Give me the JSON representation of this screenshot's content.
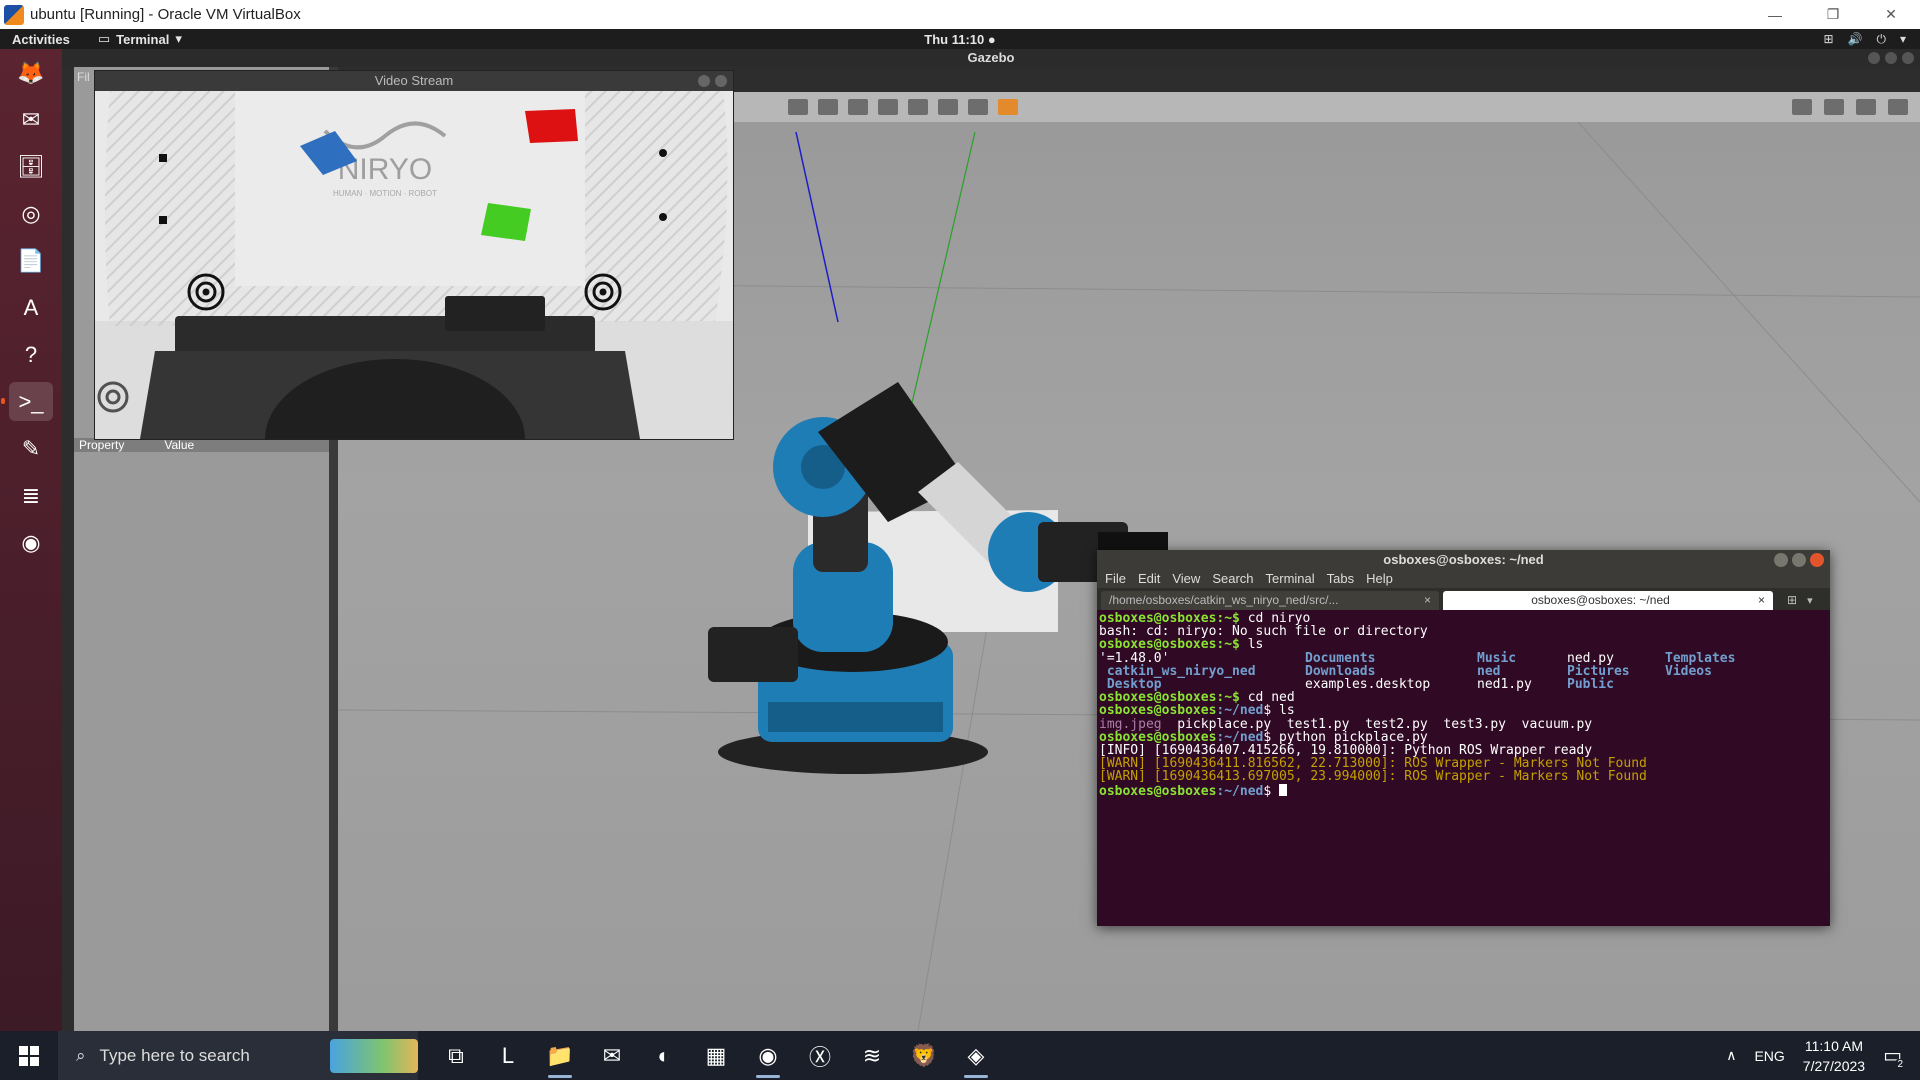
{
  "vbox": {
    "title": "ubuntu [Running] - Oracle VM VirtualBox",
    "minimize": "—",
    "restore": "❐",
    "close": "✕"
  },
  "ubuntu_panel": {
    "activities": "Activities",
    "app_menu": "Terminal",
    "clock": "Thu 11:10 ●"
  },
  "gazebo": {
    "title": "Gazebo",
    "file_menu": "Fil",
    "property_header": "Property",
    "value_header": "Value"
  },
  "video_stream": {
    "title": "Video Stream",
    "logo_text": "NIRYO",
    "logo_sub": "HUMAN · MOTION · ROBOT"
  },
  "launcher": {
    "items": [
      {
        "name": "firefox-icon",
        "glyph": "🦊",
        "active": false
      },
      {
        "name": "thunderbird-icon",
        "glyph": "✉",
        "active": false
      },
      {
        "name": "files-icon",
        "glyph": "🗄",
        "active": false
      },
      {
        "name": "rhythmbox-icon",
        "glyph": "◎",
        "active": false
      },
      {
        "name": "libreoffice-writer-icon",
        "glyph": "📄",
        "active": false
      },
      {
        "name": "software-center-icon",
        "glyph": "A",
        "active": false
      },
      {
        "name": "help-icon",
        "glyph": "?",
        "active": false
      },
      {
        "name": "terminal-icon",
        "glyph": ">_",
        "active": true
      },
      {
        "name": "text-editor-icon",
        "glyph": "✎",
        "active": false
      },
      {
        "name": "sublime-icon",
        "glyph": "≣",
        "active": false
      },
      {
        "name": "gazebo-icon",
        "glyph": "◉",
        "active": false
      }
    ]
  },
  "terminal": {
    "title": "osboxes@osboxes: ~/ned",
    "menu": [
      "File",
      "Edit",
      "View",
      "Search",
      "Terminal",
      "Tabs",
      "Help"
    ],
    "tabs": [
      {
        "label": "/home/osboxes/catkin_ws_niryo_ned/src/...",
        "close": "×"
      },
      {
        "label": "osboxes@osboxes: ~/ned",
        "close": "×"
      }
    ],
    "lines": {
      "l1_prompt": "osboxes@osboxes:~$",
      "l1_cmd": " cd niryo",
      "l2": "bash: cd: niryo: No such file or directory",
      "l3_prompt": "osboxes@osboxes:~$",
      "l3_cmd": " ls",
      "ls_row1": [
        "'=1.48.0'",
        "Documents",
        "Music",
        "ned.py",
        "Templates"
      ],
      "ls_row2": [
        " catkin_ws_niryo_ned",
        "Downloads",
        "ned",
        "Pictures",
        "Videos"
      ],
      "ls_row3": [
        " Desktop",
        "examples.desktop",
        "ned1.py",
        "Public",
        ""
      ],
      "l7_prompt": "osboxes@osboxes:~$",
      "l7_cmd": " cd ned",
      "l8_prompt_user": "osboxes@osboxes",
      "l8_prompt_path": ":~/ned",
      "l8_cmd": "$ ls",
      "l9_img": "img.jpeg",
      "l9_rest": "  pickplace.py  test1.py  test2.py  test3.py  vacuum.py",
      "l10_prompt_user": "osboxes@osboxes",
      "l10_prompt_path": ":~/ned",
      "l10_cmd": "$ python pickplace.py",
      "l11": "[INFO] [1690436407.415266, 19.810000]: Python ROS Wrapper ready",
      "l12": "[WARN] [1690436411.816562, 22.713000]: ROS Wrapper - Markers Not Found",
      "l13": "[WARN] [1690436413.697005, 23.994000]: ROS Wrapper - Markers Not Found",
      "l14_prompt_user": "osboxes@osboxes",
      "l14_prompt_path": ":~/ned",
      "l14_cmd": "$ "
    }
  },
  "taskbar": {
    "search_placeholder": "Type here to search",
    "apps": [
      {
        "name": "task-view-icon",
        "glyph": "⧉",
        "running": false
      },
      {
        "name": "l-app-icon",
        "glyph": "L",
        "running": false
      },
      {
        "name": "file-explorer-icon",
        "glyph": "📁",
        "running": true
      },
      {
        "name": "mail-icon",
        "glyph": "✉",
        "running": false
      },
      {
        "name": "edge-icon",
        "glyph": "◐",
        "running": false
      },
      {
        "name": "store-icon",
        "glyph": "▦",
        "running": false
      },
      {
        "name": "chrome-icon",
        "glyph": "◉",
        "running": true
      },
      {
        "name": "xbox-icon",
        "glyph": "Ⓧ",
        "running": false
      },
      {
        "name": "spotify-icon",
        "glyph": "≋",
        "running": false
      },
      {
        "name": "brave-icon",
        "glyph": "🦁",
        "running": false
      },
      {
        "name": "virtualbox-icon",
        "glyph": "◈",
        "running": true
      }
    ],
    "lang": "ENG",
    "time": "11:10 AM",
    "date": "7/27/2023",
    "notifications": "2"
  },
  "colors": {
    "terminal_bg": "#300a24",
    "prompt_green": "#8ae234",
    "prompt_blue": "#729fcf",
    "warn_yellow": "#c4a000",
    "ubuntu_orange": "#e95420",
    "niryo_blue": "#1a7fb8"
  }
}
